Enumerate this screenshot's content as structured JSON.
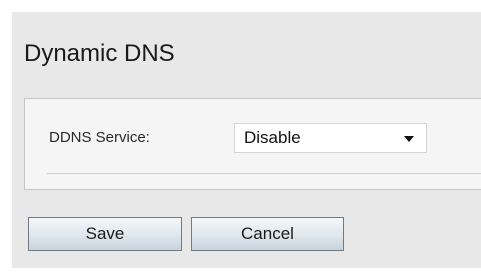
{
  "page": {
    "title": "Dynamic DNS"
  },
  "ddns": {
    "label": "DDNS Service:",
    "selected_value": "Disable"
  },
  "actions": {
    "save_label": "Save",
    "cancel_label": "Cancel"
  },
  "colors": {
    "panel_background": "#e8e8e8",
    "section_background": "#f5f5f5",
    "divider": "#c8cfe2",
    "button_border": "#6f7a85"
  }
}
